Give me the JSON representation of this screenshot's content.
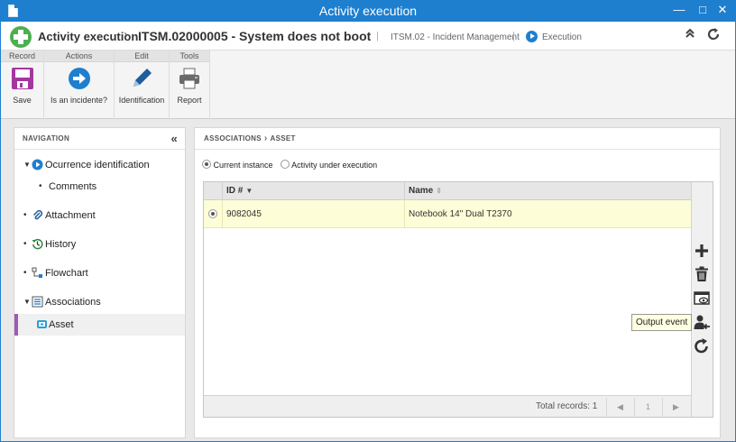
{
  "window": {
    "title": "Activity execution",
    "minimize": "—",
    "maximize": "□",
    "close": "✕"
  },
  "header": {
    "app_title": "Activity execution",
    "record_title": "ITSM.02000005 - System does not boot",
    "process": "ITSM.02 - Incident Management",
    "status": "Execution",
    "separator": "|"
  },
  "ribbon": {
    "groups": [
      {
        "label": "Record"
      },
      {
        "label": "Actions"
      },
      {
        "label": "Edit"
      },
      {
        "label": "Tools"
      }
    ],
    "buttons": {
      "save": "Save",
      "is_incident": "Is an incidente?",
      "identification": "Identification",
      "report": "Report"
    }
  },
  "navigation": {
    "header": "NAVIGATION",
    "items": [
      {
        "label": "Ocurrence identification",
        "icon": "play-circle-icon"
      },
      {
        "label": "Comments"
      },
      {
        "label": "Attachment",
        "icon": "paperclip-icon"
      },
      {
        "label": "History",
        "icon": "history-clock-icon"
      },
      {
        "label": "Flowchart",
        "icon": "flowchart-icon"
      },
      {
        "label": "Associations",
        "icon": "associations-icon"
      },
      {
        "label": "Asset",
        "icon": "asset-icon",
        "selected": true
      }
    ]
  },
  "main": {
    "breadcrumb": [
      "ASSOCIATIONS",
      "ASSET"
    ],
    "radios": [
      {
        "label": "Current instance",
        "checked": true
      },
      {
        "label": "Activity under execution",
        "checked": false
      }
    ],
    "table": {
      "columns": [
        "ID #",
        "Name"
      ],
      "rows": [
        {
          "id": "9082045",
          "name": "Notebook 14\" Dual T2370"
        }
      ],
      "total_records": "Total records: 1",
      "page": "1"
    },
    "toolbar_tooltip": "Output event"
  },
  "colors": {
    "titlebar": "#1e7fcf",
    "accent": "#1e7fcf",
    "selected_row": "#fdfdd7",
    "nav_selected_marker": "#9c5bb5"
  }
}
